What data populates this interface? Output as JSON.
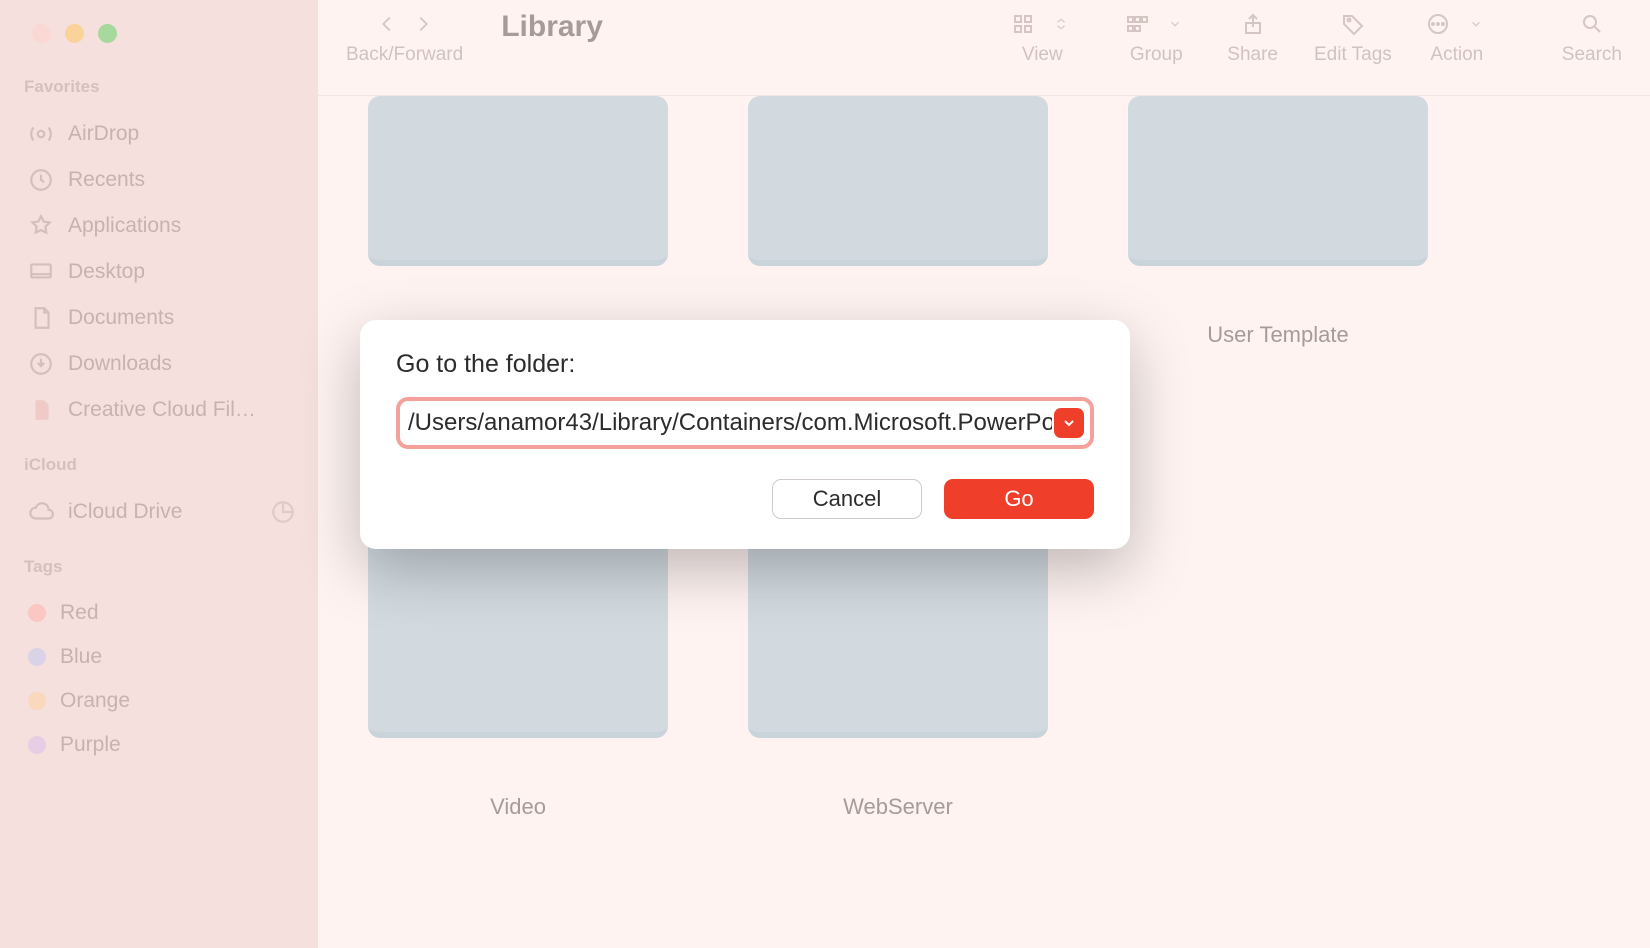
{
  "window": {
    "title": "Library",
    "back_forward_label": "Back/Forward"
  },
  "toolbar": {
    "view": "View",
    "group": "Group",
    "share": "Share",
    "edit_tags": "Edit Tags",
    "action": "Action",
    "search": "Search"
  },
  "sidebar": {
    "favorites_header": "Favorites",
    "favorites": [
      {
        "icon": "airdrop",
        "label": "AirDrop"
      },
      {
        "icon": "clock",
        "label": "Recents"
      },
      {
        "icon": "apps",
        "label": "Applications"
      },
      {
        "icon": "desktop",
        "label": "Desktop"
      },
      {
        "icon": "doc",
        "label": "Documents"
      },
      {
        "icon": "download",
        "label": "Downloads"
      },
      {
        "icon": "file",
        "label": "Creative Cloud Fil…"
      }
    ],
    "icloud_header": "iCloud",
    "icloud_item": "iCloud Drive",
    "tags_header": "Tags",
    "tags": [
      {
        "color": "red",
        "label": "Red"
      },
      {
        "color": "blue",
        "label": "Blue"
      },
      {
        "color": "orange",
        "label": "Orange"
      },
      {
        "color": "purple",
        "label": "Purple"
      }
    ]
  },
  "folders_row1": [
    {
      "name": ""
    },
    {
      "name": ""
    },
    {
      "name": "User Template"
    }
  ],
  "folders_row2": [
    {
      "name": "Video"
    },
    {
      "name": "WebServer"
    }
  ],
  "dialog": {
    "title": "Go to the folder:",
    "path": "/Users/anamor43/Library/Containers/com.Microsoft.PowerPo",
    "cancel": "Cancel",
    "go": "Go"
  }
}
